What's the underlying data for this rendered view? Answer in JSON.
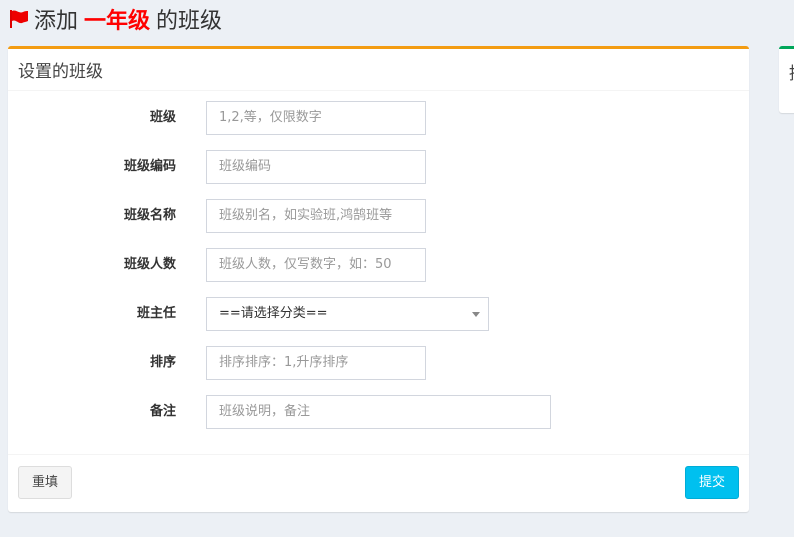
{
  "page": {
    "title_prefix": "添加",
    "title_highlight": "一年级",
    "title_suffix": "的班级"
  },
  "form_box": {
    "header": "设置的班级",
    "fields": [
      {
        "label": "班级",
        "placeholder": "1,2,等，仅限数字",
        "value": ""
      },
      {
        "label": "班级编码",
        "placeholder": "班级编码",
        "value": ""
      },
      {
        "label": "班级名称",
        "placeholder": "班级别名，如实验班,鸿鹄班等",
        "value": ""
      },
      {
        "label": "班级人数",
        "placeholder": "班级人数，仅写数字，如：50",
        "value": ""
      },
      {
        "label": "班主任",
        "selected": "==请选择分类=="
      },
      {
        "label": "排序",
        "placeholder": "排序排序：1,升序排序",
        "value": ""
      },
      {
        "label": "备注",
        "placeholder": "班级说明，备注",
        "value": ""
      }
    ],
    "reset_label": "重填",
    "submit_label": "提交"
  },
  "side_box": {
    "header": "提"
  },
  "colors": {
    "background": "#ecf0f5",
    "warning_border": "#f39c12",
    "success_border": "#00a65a",
    "highlight_red": "#ff0000",
    "submit_blue": "#00c0ef"
  },
  "icons": {
    "title": "flag-icon",
    "select": "caret-down-icon"
  }
}
